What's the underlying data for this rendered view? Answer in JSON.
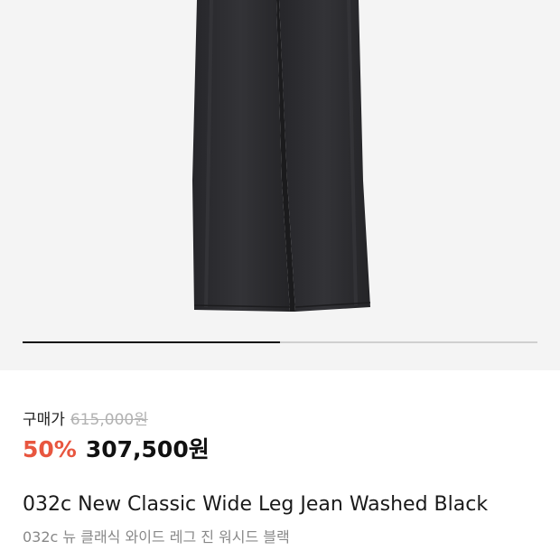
{
  "product": {
    "image": {
      "alt": "wide leg jeans washed black",
      "color": "#2b2b2e"
    },
    "gallery_progress": 0.5,
    "price_label": "구매가",
    "original_price": "615,000원",
    "discount": "50%",
    "sale_price": "307,500원",
    "name_en": "032c New Classic Wide Leg Jean Washed Black",
    "name_ko": "032c 뉴 클래식 와이드 레그 진 워시드 블랙"
  },
  "colors": {
    "discount": "#e8563f",
    "hero_bg": "#f4f4f4",
    "strike_price": "#b2b2b2"
  }
}
